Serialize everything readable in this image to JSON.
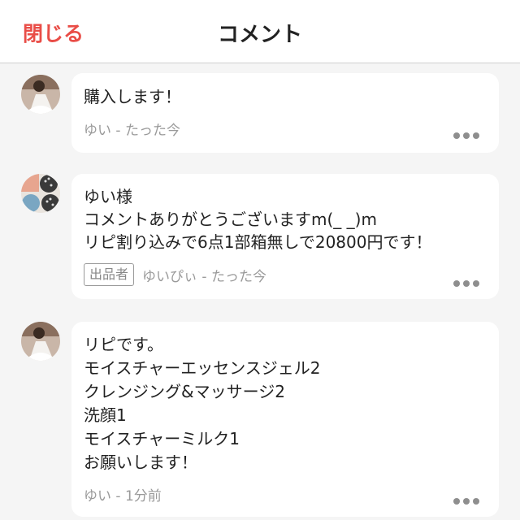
{
  "header": {
    "close_label": "閉じる",
    "title": "コメント"
  },
  "comments": [
    {
      "avatar": "user-photo-icon",
      "lines": [
        "購入します！"
      ],
      "author": "ゆい",
      "time": "たった今",
      "seller_badge": ""
    },
    {
      "avatar": "seller-photo-icon",
      "lines": [
        "ゆい様",
        "コメントありがとうございますm(_ _)m",
        "リピ割り込みで6点1部箱無しで20800円です！"
      ],
      "author": "ゆいぴぃ",
      "time": "たった今",
      "seller_badge": "出品者"
    },
    {
      "avatar": "user-photo-icon",
      "lines": [
        "リピです。",
        "モイスチャーエッセンスジェル2",
        "クレンジング&マッサージ2",
        "洗顔1",
        "モイスチャーミルク1",
        "お願いします！"
      ],
      "author": "ゆい",
      "time": "1分前",
      "seller_badge": ""
    }
  ],
  "separator": " - ",
  "colors": {
    "accent": "#e94d47",
    "meta": "#9a9a9a",
    "background": "#f5f5f5"
  }
}
